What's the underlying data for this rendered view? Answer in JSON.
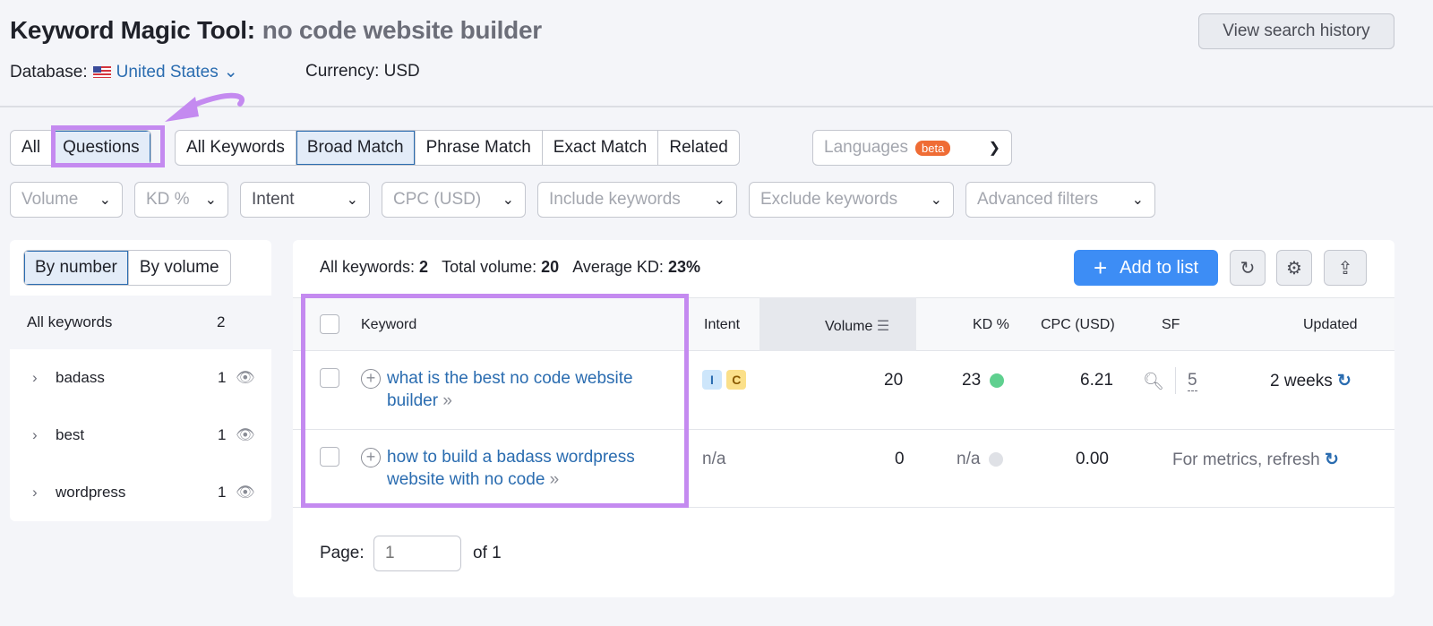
{
  "header": {
    "title": "Keyword Magic Tool:",
    "query": "no code website builder",
    "history_button": "View search history",
    "database_label": "Database:",
    "database_value": "United States",
    "currency": "Currency: USD"
  },
  "tabs": {
    "group1": [
      "All",
      "Questions"
    ],
    "group2": [
      "All Keywords",
      "Broad Match",
      "Phrase Match",
      "Exact Match",
      "Related"
    ],
    "selected": [
      "Questions",
      "Broad Match"
    ],
    "languages": "Languages",
    "beta": "beta"
  },
  "filters": [
    "Volume",
    "KD %",
    "Intent",
    "CPC (USD)",
    "Include keywords",
    "Exclude keywords",
    "Advanced filters"
  ],
  "sidebar": {
    "toggle": [
      "By number",
      "By volume"
    ],
    "all_label": "All keywords",
    "all_count": "2",
    "groups": [
      {
        "label": "badass",
        "count": "1"
      },
      {
        "label": "best",
        "count": "1"
      },
      {
        "label": "wordpress",
        "count": "1"
      }
    ]
  },
  "summary": {
    "all_label": "All keywords:",
    "all_value": "2",
    "volume_label": "Total volume:",
    "volume_value": "20",
    "kd_label": "Average KD:",
    "kd_value": "23%"
  },
  "toolbar": {
    "add_to_list": "Add to list"
  },
  "table": {
    "headers": [
      "Keyword",
      "Intent",
      "Volume",
      "KD %",
      "CPC (USD)",
      "SF",
      "Updated"
    ],
    "rows": [
      {
        "keyword": "what is the best no code website builder",
        "intent": [
          "I",
          "C"
        ],
        "volume": "20",
        "kd": "23",
        "kd_color": "#5fd08f",
        "cpc": "6.21",
        "sf": "5",
        "updated": "2 weeks"
      },
      {
        "keyword": "how to build a badass wordpress website with no code",
        "intent_text": "n/a",
        "volume": "0",
        "kd": "n/a",
        "kd_color": "#dfe1e6",
        "cpc": "0.00",
        "updated": "For metrics, refresh"
      }
    ]
  },
  "pagination": {
    "label": "Page:",
    "placeholder": "1",
    "of": "of 1"
  },
  "colors": {
    "accent": "#2a6cb0",
    "primary_button": "#3d8df5",
    "highlight": "#c48af0",
    "intent_i": "#cde6fb",
    "intent_c": "#fbe08a"
  }
}
